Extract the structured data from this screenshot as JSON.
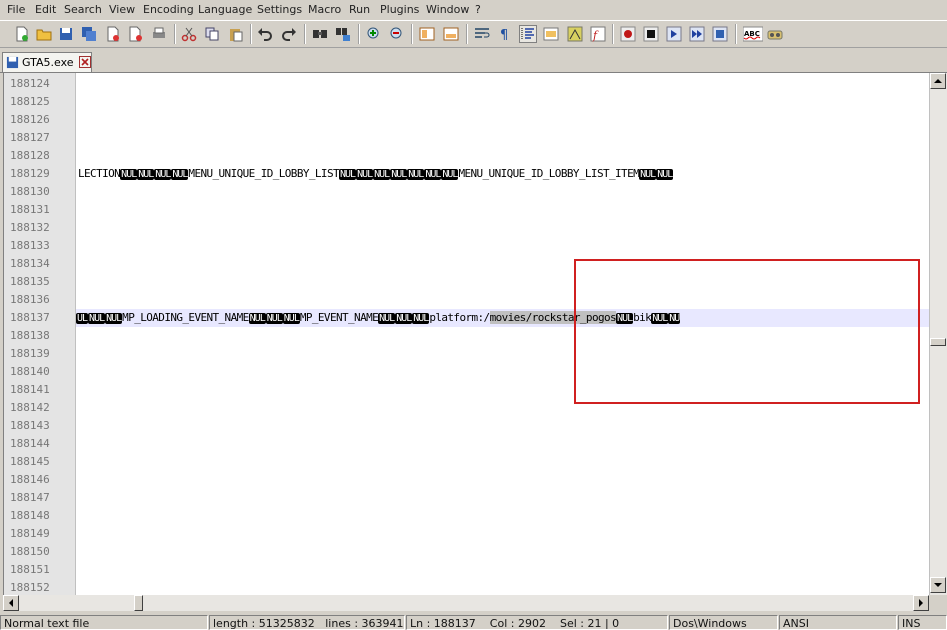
{
  "menu": [
    "File",
    "Edit",
    "Search",
    "View",
    "Encoding",
    "Language",
    "Settings",
    "Macro",
    "Run",
    "Plugins",
    "Window",
    "?"
  ],
  "toolbar": {
    "icons": [
      "new-file-icon",
      "open-file-icon",
      "save-icon",
      "save-all-icon",
      "close-icon",
      "close-all-icon",
      "print-icon",
      "cut-icon",
      "copy-icon",
      "paste-icon",
      "undo-icon",
      "redo-icon",
      "find-icon",
      "replace-icon",
      "zoom-in-icon",
      "zoom-out-icon",
      "sync-vertical-icon",
      "sync-horizontal-icon",
      "word-wrap-icon",
      "show-all-chars-icon",
      "indent-guide-icon",
      "user-lang-icon",
      "doc-map-icon",
      "function-list-icon",
      "record-macro-icon",
      "stop-record-icon",
      "play-macro-icon",
      "run-macro-multiple-icon",
      "save-macro-icon",
      "spell-check-icon",
      "spell-check-options-icon"
    ],
    "spell_label": "ABC"
  },
  "tab": {
    "label": "GTA5.exe"
  },
  "editor": {
    "line_numbers": [
      "188124",
      "188125",
      "188126",
      "188127",
      "188128",
      "188129",
      "188130",
      "188131",
      "188132",
      "188133",
      "188134",
      "188135",
      "188136",
      "188137",
      "188138",
      "188139",
      "188140",
      "188141",
      "188142",
      "188143",
      "188144",
      "188145",
      "188146",
      "188147",
      "188148",
      "188149",
      "188150",
      "188151",
      "188152"
    ],
    "nul": "NUL",
    "line_188129": {
      "part1": "LECTION",
      "part2": "MENU_UNIQUE_ID_LOBBY_LIST",
      "part3": "MENU_UNIQUE_ID_LOBBY_LIST_ITEM"
    },
    "line_188137": {
      "prefix": "UL",
      "part1": "MP_LOADING_EVENT_NAME",
      "part2": "MP_EVENT_NAME",
      "part3_plain": "platform:/",
      "part3_selected": "movies/rockstar_pogos",
      "part4": "bik",
      "tail": "NU"
    }
  },
  "status": {
    "type": "Normal text file",
    "length": "length : 51325832",
    "lines": "lines : 363941",
    "ln": "Ln : 188137",
    "col": "Col : 2902",
    "sel": "Sel : 21 | 0",
    "eol": "Dos\\Windows",
    "encoding": "ANSI",
    "mode": "INS"
  },
  "colors": {
    "highlight_box": "#d02020",
    "current_line": "#e8e8ff",
    "nul_bg": "#000000"
  }
}
